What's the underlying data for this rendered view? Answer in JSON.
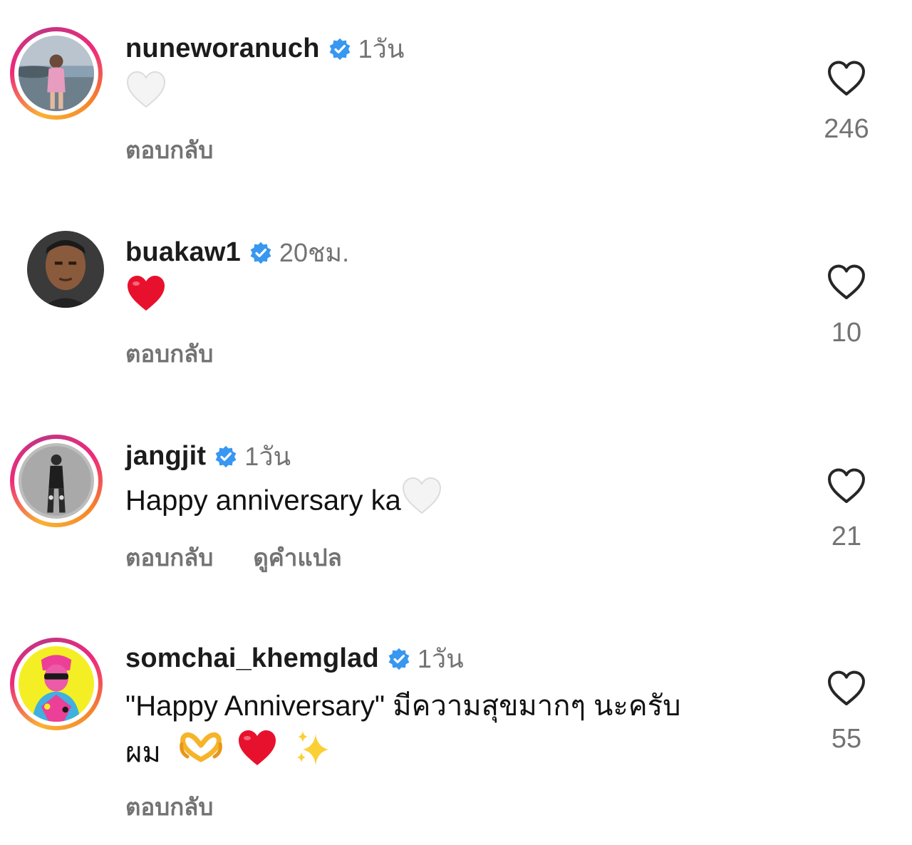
{
  "comments": [
    {
      "username": "nuneworanuch",
      "verified": true,
      "timestamp": "1วัน",
      "text": "",
      "emoji": [
        "white-heart-icon"
      ],
      "actions": [
        "ตอบกลับ"
      ],
      "likes": "246",
      "has_story_ring": true
    },
    {
      "username": "buakaw1",
      "verified": true,
      "timestamp": "20ชม.",
      "text": "",
      "emoji": [
        "red-heart-icon"
      ],
      "actions": [
        "ตอบกลับ"
      ],
      "likes": "10",
      "has_story_ring": false
    },
    {
      "username": "jangjit",
      "verified": true,
      "timestamp": "1วัน",
      "text": "Happy anniversary ka",
      "emoji": [
        "white-heart-icon"
      ],
      "actions": [
        "ตอบกลับ",
        "ดูคำแปล"
      ],
      "likes": "21",
      "has_story_ring": true
    },
    {
      "username": "somchai_khemglad",
      "verified": true,
      "timestamp": "1วัน",
      "text_line1": "\"Happy Anniversary\" มีความสุขมากๆ นะครับ",
      "text_line2": "ผม",
      "emoji": [
        "heart-hands-icon",
        "red-heart-icon",
        "sparkles-icon"
      ],
      "actions": [
        "ตอบกลับ"
      ],
      "likes": "55",
      "has_story_ring": true
    }
  ],
  "colors": {
    "verified_blue": "#3897f0",
    "muted_text": "#737373",
    "red_heart": "#e8112d",
    "sparkle_yellow": "#fbd035"
  }
}
